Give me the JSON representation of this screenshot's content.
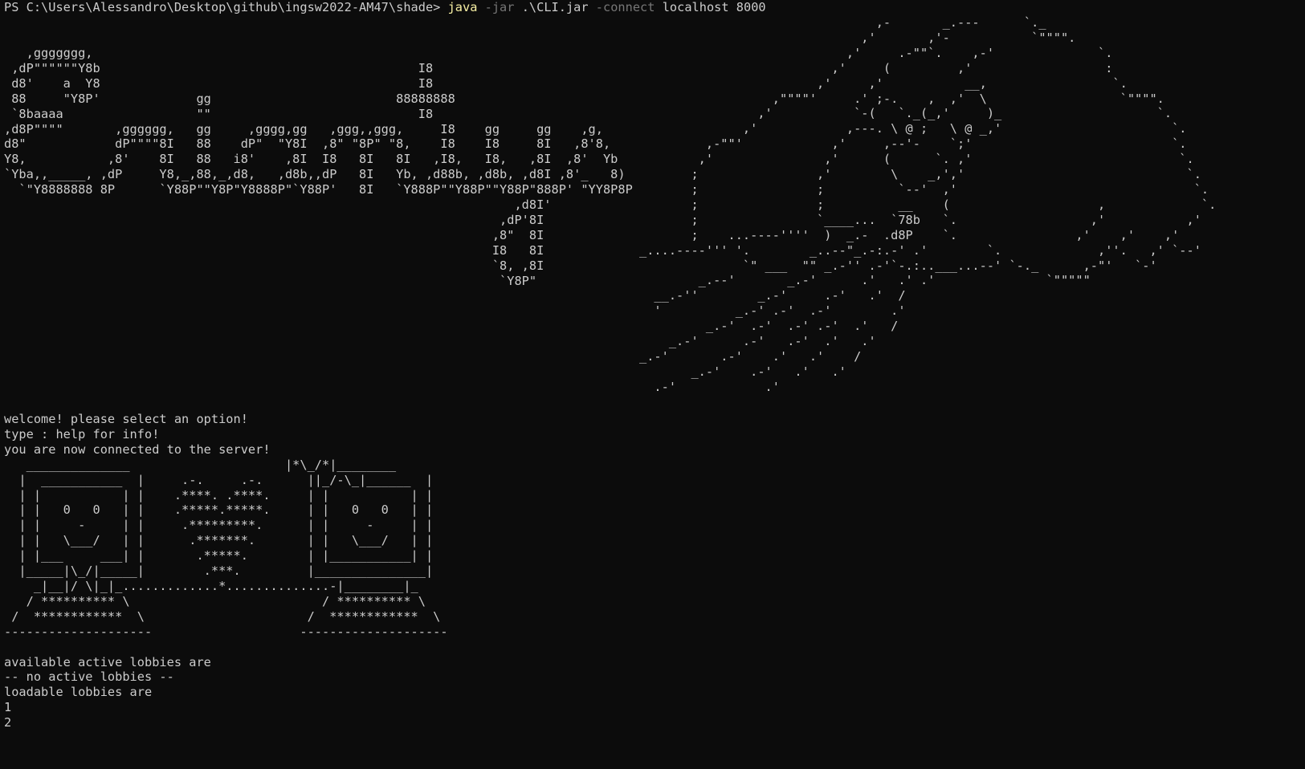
{
  "terminal": {
    "prompt": "PS C:\\Users\\Alessandro\\Desktop\\github\\ingsw2022-AM47\\shade> ",
    "cmd_java": "java",
    "cmd_jar_flag": " -jar",
    "cmd_jar_path": " .\\CLI.jar",
    "cmd_connect_flag": " -connect",
    "cmd_host": " localhost",
    "cmd_port": " 8000"
  },
  "logo_art": [
    "   ,ggggggg,",
    " ,dP\"\"\"\"\"\"Y8b                                           I8",
    " d8'    a  Y8                                           I8",
    " 88     \"Y8P'             gg                         88888888",
    " `8baaaa                  \"\"                            I8",
    ",d8P\"\"\"\"       ,gggggg,   gg     ,gggg,gg   ,ggg,,ggg,     I8    gg     gg    ,g,",
    "d8\"            dP\"\"\"\"8I   88    dP\"  \"Y8I  ,8\" \"8P\" \"8,    I8    I8     8I   ,8'8,",
    "Y8,           ,8'    8I   88   i8'    ,8I  I8   8I   8I   ,I8,   I8,   ,8I  ,8'  Yb",
    "`Yba,,_____, ,dP     Y8,_,88,_,d8,   ,d8b,,dP   8I   Yb, ,d88b, ,d8b, ,d8I ,8'_   8)",
    "  `\"Y8888888 8P      `Y88P\"\"Y8P\"Y8888P\"`Y88P'   8I   `Y888P\"\"Y88P\"\"Y88P\"888P' \"YY8P8P",
    "                                                                     ,d8I'",
    "                                                                   ,dP'8I",
    "                                                                  ,8\"  8I",
    "                                                                  I8   8I",
    "                                                                  `8, ,8I",
    "                                                                   `Y8P\""
  ],
  "owl_art": [
    "                                ,-       _.---      `._",
    "                              ,'       ,'-           `\"\"\"\".",
    "                            ,'     .-\"\"`.    ,-'              `.",
    "                          ,'     (         ,'                  :",
    "                        ,'     ,'           __,                 `.",
    "                  ,\"\"\"\"'     .' ;-.    ,  ,'  \\                  `\"\"\"\".",
    "                ,'           `-(   `._(_,'     )_                     `.",
    "              ,'            ,---. \\ @ ;   \\ @ _,'                       `.",
    "         ,-\"\"'            ,'     ,--'-    `;'                           `.",
    "        ,'               ,'      (      `. ,'                            `.",
    "       ;                ,'        \\    _,','                              `.",
    "       ;                ;          `--'  ,'                                `.",
    "       ;                ;          __    (                    ,             `.",
    "       ;                `____...  `78b   `.                  ,'           ,'",
    "       ;    ...----''''  )  _.-  .d8P    `.                ,'    ,'    ,'",
    "_....----''' '.        _..--\"_.-:.-' .'        `.             ,''.   ,' `--'",
    "              `\" ___  \"\" _.-'' .-'`-.:..___...--' `-._      ,-\"'   `-'",
    "        _.--'       _.-'      .'   .' .'               `\"\"\"\"\"",
    "  __.-''        _.-'     .-'   .'  /",
    "  '          _.-' .-'  .-'        .'",
    "         _.-'  .-'  .-' .-'  .'   /",
    "    _.-'      .-'   .-'  .'   .'",
    "_.-'       .-'    .'   .'    /",
    "       _.-'    .-'   .'   .'",
    "  .-'            .'"
  ],
  "messages": [
    "welcome! please select an option!",
    "type : help for info!",
    "you are now connected to the server!"
  ],
  "lobby_art": [
    "   ______________                     |*\\_/*|________",
    "  |  ___________  |     .-.     .-.      ||_/-\\_|______  |",
    "  | |           | |    .****. .****.     | |           | |",
    "  | |   0   0   | |    .*****.*****.     | |   0   0   | |",
    "  | |     -     | |     .*********.      | |     -     | |",
    "  | |   \\___/   | |      .*******.       | |   \\___/   | |",
    "  | |___     ___| |       .*****.        | |___________| |",
    "  |_____|\\_/|_____|        .***.         |_______________|",
    "    _|__|/ \\|_|_.............*..............-|________|_",
    "   / ********** \\                          / ********** \\",
    " /  ************  \\                      /  ************  \\",
    "--------------------                    --------------------"
  ],
  "lobbies": {
    "active_header": "available active lobbies are",
    "none_active": "-- no active lobbies --",
    "loadable_header": "loadable lobbies are",
    "loadable_items": [
      "1",
      "2"
    ]
  }
}
